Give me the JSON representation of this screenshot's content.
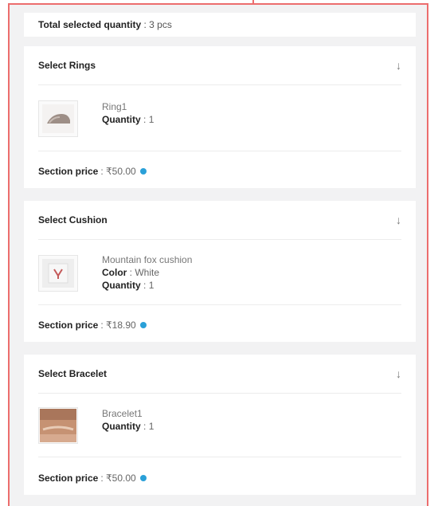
{
  "summary": {
    "label": "Total selected quantity",
    "value": "3 pcs"
  },
  "sections": [
    {
      "title": "Select Rings",
      "item": {
        "name": "Ring1",
        "quantity_label": "Quantity",
        "quantity": "1"
      },
      "price_label": "Section price",
      "price": "₹50.00"
    },
    {
      "title": "Select Cushion",
      "item": {
        "name": "Mountain fox cushion",
        "color_label": "Color",
        "color": "White",
        "quantity_label": "Quantity",
        "quantity": "1"
      },
      "price_label": "Section price",
      "price": "₹18.90"
    },
    {
      "title": "Select Bracelet",
      "item": {
        "name": "Bracelet1",
        "quantity_label": "Quantity",
        "quantity": "1"
      },
      "price_label": "Section price",
      "price": "₹50.00"
    }
  ],
  "colors": {
    "frame_border": "#ec6d6d",
    "info_dot": "#2aa0d8",
    "panel_bg": "#f2f2f3"
  },
  "icons": {
    "expand": "arrow-down-icon",
    "info": "info-dot-icon"
  }
}
